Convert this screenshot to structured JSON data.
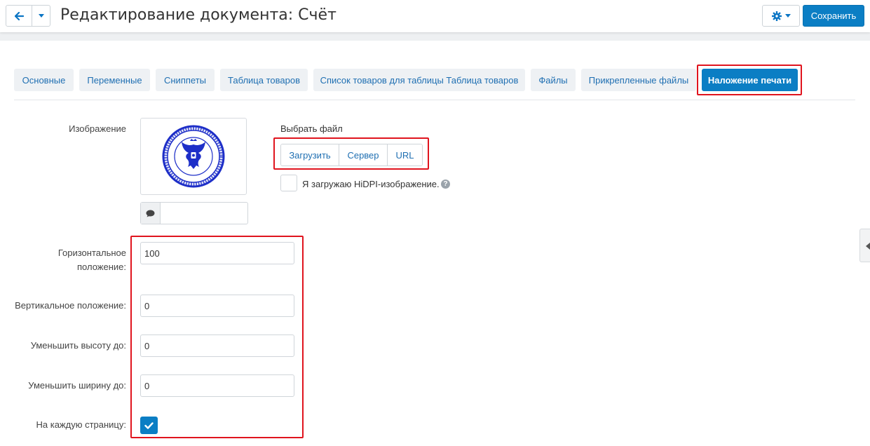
{
  "header": {
    "title": "Редактирование документа: Счёт",
    "save_label": "Сохранить"
  },
  "tabs": [
    {
      "label": "Основные"
    },
    {
      "label": "Переменные"
    },
    {
      "label": "Сниппеты"
    },
    {
      "label": "Таблица товаров"
    },
    {
      "label": "Список товаров для таблицы Таблица товаров"
    },
    {
      "label": "Файлы"
    },
    {
      "label": "Прикрепленные файлы"
    },
    {
      "label": "Наложение печати"
    }
  ],
  "active_tab": "Наложение печати",
  "form": {
    "image_label": "Изображение",
    "choose_file_label": "Выбрать файл",
    "upload_buttons": [
      "Загрузить",
      "Сервер",
      "URL"
    ],
    "hidpi_label": "Я загружаю HiDPI-изображение.",
    "hidpi_checked": false,
    "comment_value": "",
    "horizontal_label": "Горизонтальное положение:",
    "horizontal_value": "100",
    "vertical_label": "Вертикальное положение:",
    "vertical_value": "0",
    "height_label": "Уменьшить высоту до:",
    "height_value": "0",
    "width_label": "Уменьшить ширину до:",
    "width_value": "0",
    "every_page_label": "На каждую страницу:",
    "every_page_checked": true
  },
  "colors": {
    "accent": "#0b7ec4",
    "highlight": "#e0141e",
    "stamp": "#1e2fc8"
  },
  "icons": {
    "back": "arrow-left-icon",
    "dropdown": "caret-down-icon",
    "settings": "gear-icon",
    "comment": "comment-icon",
    "help": "question-icon",
    "check": "check-icon",
    "side": "chevron-left-icon"
  }
}
